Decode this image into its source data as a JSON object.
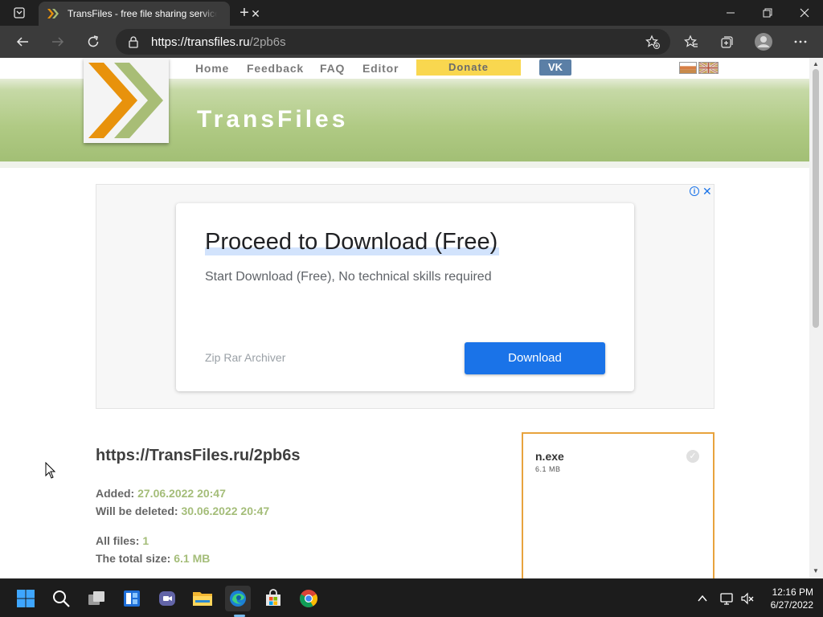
{
  "browser": {
    "tab_title": "TransFiles - free file sharing service",
    "tab_close": "✕",
    "new_tab": "+",
    "url_host": "https://transfiles.ru",
    "url_path": "/2pb6s"
  },
  "site": {
    "nav": [
      "Home",
      "Feedback",
      "FAQ",
      "Editor"
    ],
    "donate": "Donate",
    "vk": "VK",
    "title": "TransFiles",
    "colors": {
      "header_green": "#b0ca84",
      "donate_yellow": "#f9d74f",
      "vk_blue": "#5b7fa6",
      "accent_orange": "#e8a33d",
      "value_green": "#a4bd79"
    }
  },
  "ad": {
    "headline": "Proceed to Download (Free)",
    "subtext": "Start Download (Free), No technical skills required",
    "brand": "Zip Rar Archiver",
    "button": "Download",
    "info_icon": "i",
    "close_icon": "✕"
  },
  "file_page": {
    "link": "https://TransFiles.ru/2pb6s",
    "added_label": "Added:",
    "added_value": "27.06.2022 20:47",
    "deleted_label": "Will be deleted:",
    "deleted_value": "30.06.2022 20:47",
    "all_files_label": "All files:",
    "all_files_value": "1",
    "total_size_label": "The total size:",
    "total_size_value": "6.1 MB"
  },
  "file_card": {
    "name": "n.exe",
    "size": "6.1 MB",
    "check": "✓"
  },
  "taskbar": {
    "time": "12:16 PM",
    "date": "6/27/2022"
  }
}
